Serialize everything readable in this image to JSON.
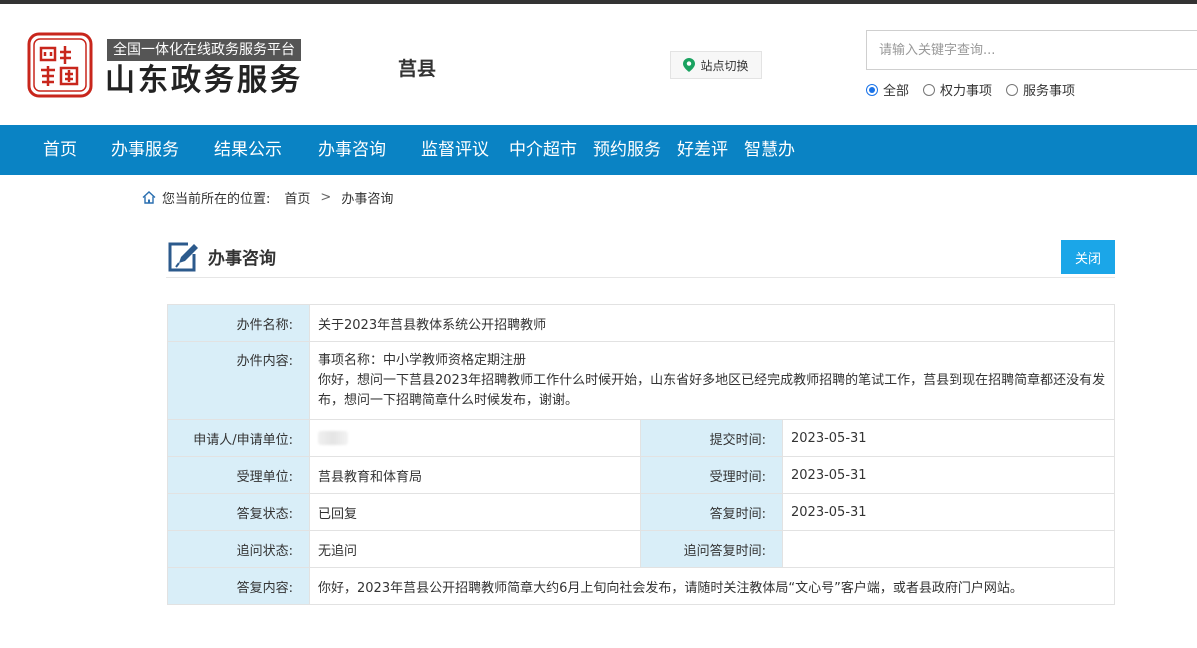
{
  "header": {
    "platform_label": "全国一体化在线政务服务平台",
    "brand_name": "山东政务服务",
    "region": "莒县",
    "site_switch_label": "站点切换",
    "search": {
      "placeholder": "请输入关键字查询...",
      "value": ""
    },
    "search_scopes": [
      {
        "label": "全部",
        "selected": true
      },
      {
        "label": "权力事项",
        "selected": false
      },
      {
        "label": "服务事项",
        "selected": false
      }
    ]
  },
  "nav": {
    "items": [
      "首页",
      "办事服务",
      "结果公示",
      "办事咨询",
      "监督评议",
      "中介超市",
      "预约服务",
      "好差评",
      "智慧办"
    ]
  },
  "breadcrumb": {
    "prefix": "您当前所在的位置:",
    "items": [
      "首页",
      "办事咨询"
    ],
    "separator": ">"
  },
  "section": {
    "title": "办事咨询",
    "close_label": "关闭"
  },
  "detail": {
    "case_name_label": "办件名称:",
    "case_name": "关于2023年莒县教体系统公开招聘教师",
    "case_content_label": "办件内容:",
    "case_content_line1": "事项名称：中小学教师资格定期注册",
    "case_content_line2": "你好，想问一下莒县2023年招聘教师工作什么时候开始，山东省好多地区已经完成教师招聘的笔试工作，莒县到现在招聘简章都还没有发布，想问一下招聘简章什么时候发布，谢谢。",
    "applicant_label": "申请人/申请单位:",
    "submit_time_label": "提交时间:",
    "submit_time": "2023-05-31",
    "accept_unit_label": "受理单位:",
    "accept_unit": "莒县教育和体育局",
    "accept_time_label": "受理时间:",
    "accept_time": "2023-05-31",
    "reply_status_label": "答复状态:",
    "reply_status": "已回复",
    "reply_time_label": "答复时间:",
    "reply_time": "2023-05-31",
    "followup_status_label": "追问状态:",
    "followup_status": "无追问",
    "followup_reply_time_label": "追问答复时间:",
    "followup_reply_time": "",
    "reply_content_label": "答复内容:",
    "reply_content": "你好，2023年莒县公开招聘教师简章大约6月上旬向社会发布，请随时关注教体局“文心号”客户端，或者县政府门户网站。"
  },
  "colors": {
    "nav_bg": "#0a83c4",
    "label_bg": "#d9eef8",
    "close_button": "#1ba6e8",
    "seal_red": "#c8261c"
  },
  "icons": {
    "logo": "china-seal-icon",
    "location": "map-pin-icon",
    "home": "home-icon",
    "section": "edit-document-icon"
  }
}
